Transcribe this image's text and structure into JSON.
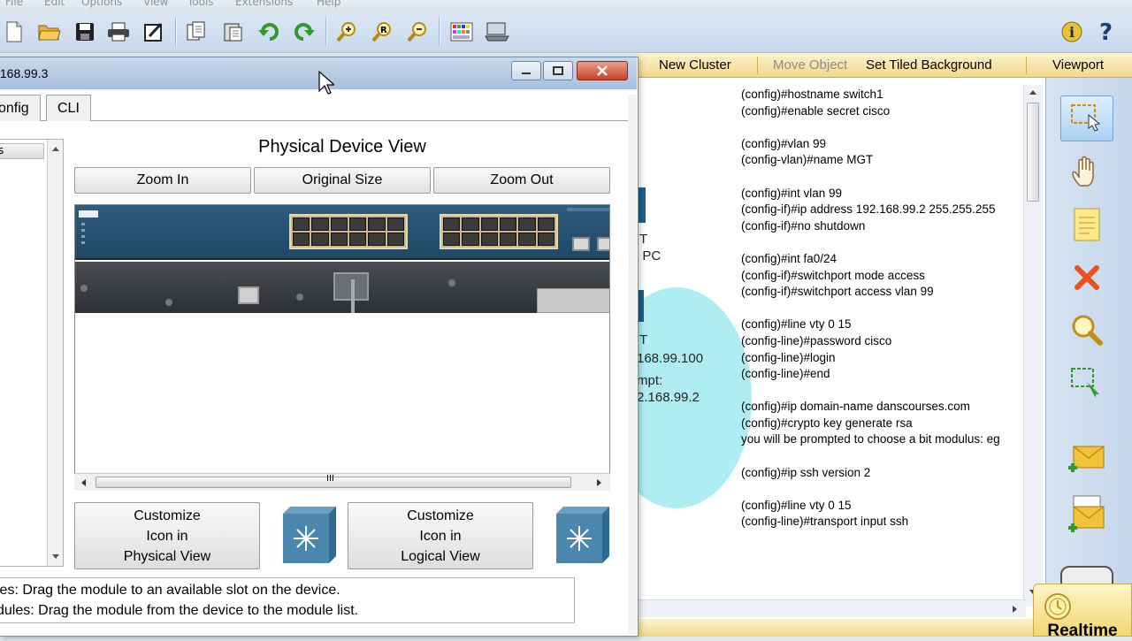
{
  "menu": [
    "File",
    "Edit",
    "Options",
    "View",
    "Tools",
    "Extensions",
    "Help"
  ],
  "toolbar_icons": [
    "new-file-icon",
    "open-folder-icon",
    "save-icon",
    "print-icon",
    "activity-wizard-icon",
    "copy-icon",
    "paste-icon",
    "undo-icon",
    "redo-icon",
    "zoom-in-icon",
    "zoom-reset-icon",
    "zoom-out-icon",
    "palette-icon",
    "custom-device-icon",
    "info-icon",
    "help-icon"
  ],
  "workspace_bar": {
    "new_cluster": "New Cluster",
    "move_object": "Move Object",
    "set_tiled_background": "Set Tiled Background",
    "viewport": "Viewport"
  },
  "workspace_fragments": {
    "label_t1": "T",
    "label_pc": ": PC",
    "label_t2": "T",
    "ip_fragment": "168.99.100",
    "prompt_fragment": "mpt:",
    "gateway_fragment": "2.168.99.2"
  },
  "cli_notes": [
    "(config)#hostname switch1",
    "(config)#enable secret cisco",
    "",
    "(config)#vlan 99",
    "(config-vlan)#name MGT",
    "",
    "(config)#int vlan 99",
    "(config-if)#ip address 192.168.99.2 255.255.255",
    "(config-if)#no shutdown",
    "",
    "(config)#int fa0/24",
    "(config-if)#switchport mode access",
    "(config-if)#switchport access vlan 99",
    "",
    "(config)#line vty 0 15",
    "(config-line)#password cisco",
    "(config-line)#login",
    "(config-line)#end",
    "",
    "(config)#ip domain-name danscourses.com",
    "(config)#crypto key generate rsa",
    "  you will be prompted to choose a bit modulus: eg",
    "",
    "(config)#ip ssh version 2",
    "",
    "(config)#line vty 0 15",
    "(config-line)#transport input ssh"
  ],
  "palette": {
    "realtime": "Realtime"
  },
  "dialog": {
    "title_fragment": ".168.99.3",
    "tabs": {
      "config": "onfig",
      "cli": "CLI"
    },
    "list_header": "s",
    "physical_device_view": "Physical Device View",
    "zoom_in": "Zoom In",
    "original_size": "Original Size",
    "zoom_out": "Zoom Out",
    "scroll_grip": "III",
    "customize_physical": [
      "Customize",
      "Icon in",
      "Physical View"
    ],
    "customize_logical": [
      "Customize",
      "Icon in",
      "Logical View"
    ],
    "info_lines": [
      "les: Drag the module to an available slot on the device.",
      "dules: Drag the module from the device to the module list."
    ]
  }
}
